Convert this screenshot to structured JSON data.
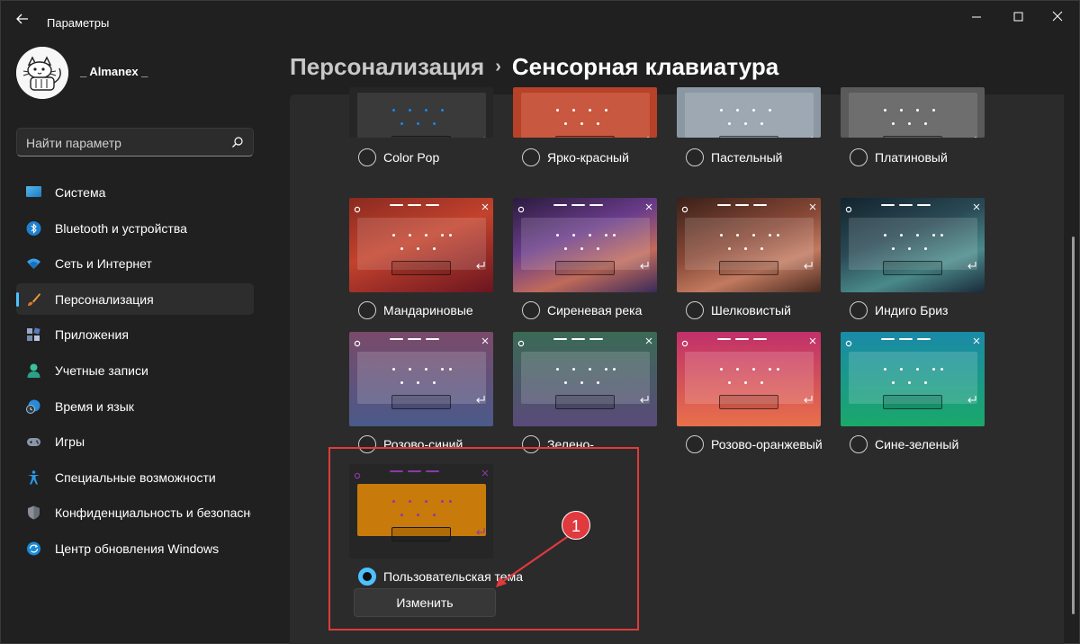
{
  "app": {
    "title": "Параметры"
  },
  "user": {
    "name": "_ Almanex _"
  },
  "search": {
    "placeholder": "Найти параметр"
  },
  "nav": [
    {
      "label": "Система",
      "icon": "display-icon"
    },
    {
      "label": "Bluetooth и устройства",
      "icon": "bluetooth-icon"
    },
    {
      "label": "Сеть и Интернет",
      "icon": "wifi-icon"
    },
    {
      "label": "Персонализация",
      "icon": "brush-icon",
      "selected": true
    },
    {
      "label": "Приложения",
      "icon": "apps-icon"
    },
    {
      "label": "Учетные записи",
      "icon": "person-icon"
    },
    {
      "label": "Время и язык",
      "icon": "globe-clock-icon"
    },
    {
      "label": "Игры",
      "icon": "gamepad-icon"
    },
    {
      "label": "Специальные возможности",
      "icon": "accessibility-icon"
    },
    {
      "label": "Конфиденциальность и безопасность",
      "icon": "shield-icon"
    },
    {
      "label": "Центр обновления Windows",
      "icon": "update-icon"
    }
  ],
  "header": {
    "parent": "Персонализация",
    "current": "Сенсорная клавиатура"
  },
  "themes": [
    {
      "label": "Color Pop",
      "bg": "#262626",
      "kb": "#3a3a3a",
      "accent": "#1a86e8",
      "partial": true
    },
    {
      "label": "Ярко-красный",
      "bg": "#b8412a",
      "kb": "#c8583f",
      "accent": "#ffffff",
      "partial": true
    },
    {
      "label": "Пастельный",
      "bg": "#8b97a3",
      "kb": "#9da8b3",
      "accent": "#ffffff",
      "partial": true
    },
    {
      "label": "Платиновый",
      "bg": "#5a5a5a",
      "kb": "#6e6e6e",
      "accent": "#ffffff",
      "partial": true
    },
    {
      "label": "Мандариновые",
      "bg": "linear-gradient(160deg,#8a2a20 0%,#c3422d 45%,#6a1520 100%)",
      "kb": "rgba(255,255,255,0.14)",
      "accent": "#ffffff"
    },
    {
      "label": "Сиреневая река",
      "bg": "linear-gradient(160deg,#2a1b3d 0%,#6a3c8a 40%,#c06a5a 70%,#3a2a5a 100%)",
      "kb": "rgba(255,255,255,0.14)",
      "accent": "#ffffff"
    },
    {
      "label": "Шелковистый",
      "bg": "linear-gradient(160deg,#3a2018 0%,#8a4a38 45%,#c27a60 70%,#4a2a20 100%)",
      "kb": "rgba(255,255,255,0.14)",
      "accent": "#ffffff"
    },
    {
      "label": "Индиго Бриз",
      "bg": "linear-gradient(160deg,#12232e 0%,#2a4a55 40%,#4a8a8a 70%,#1a2a3a 100%)",
      "kb": "rgba(255,255,255,0.14)",
      "accent": "#ffffff"
    },
    {
      "label": "Розово-синий",
      "bg": "linear-gradient(180deg,#7a4a6a 0%,#4a5a8a 100%)",
      "kb": "rgba(255,255,255,0.16)",
      "accent": "#ffffff"
    },
    {
      "label": "Зелено-фиолетовый",
      "bg": "linear-gradient(180deg,#3a6a55 0%,#5a4a7a 100%)",
      "kb": "rgba(255,255,255,0.16)",
      "accent": "#ffffff"
    },
    {
      "label": "Розово-оранжевый",
      "bg": "linear-gradient(180deg,#c0306a 0%,#e8704a 100%)",
      "kb": "rgba(255,255,255,0.16)",
      "accent": "#ffffff"
    },
    {
      "label": "Сине-зеленый",
      "bg": "linear-gradient(180deg,#1a8aa8 0%,#1aa86a 100%)",
      "kb": "rgba(255,255,255,0.16)",
      "accent": "#ffffff"
    }
  ],
  "custom_theme": {
    "label": "Пользовательская тема",
    "bg": "#262626",
    "kb": "#c87a0a",
    "accent": "#8a3aa8",
    "selected": true
  },
  "edit_button": {
    "label": "Изменить"
  },
  "annotation": {
    "number": "1",
    "color": "#e0393e"
  }
}
